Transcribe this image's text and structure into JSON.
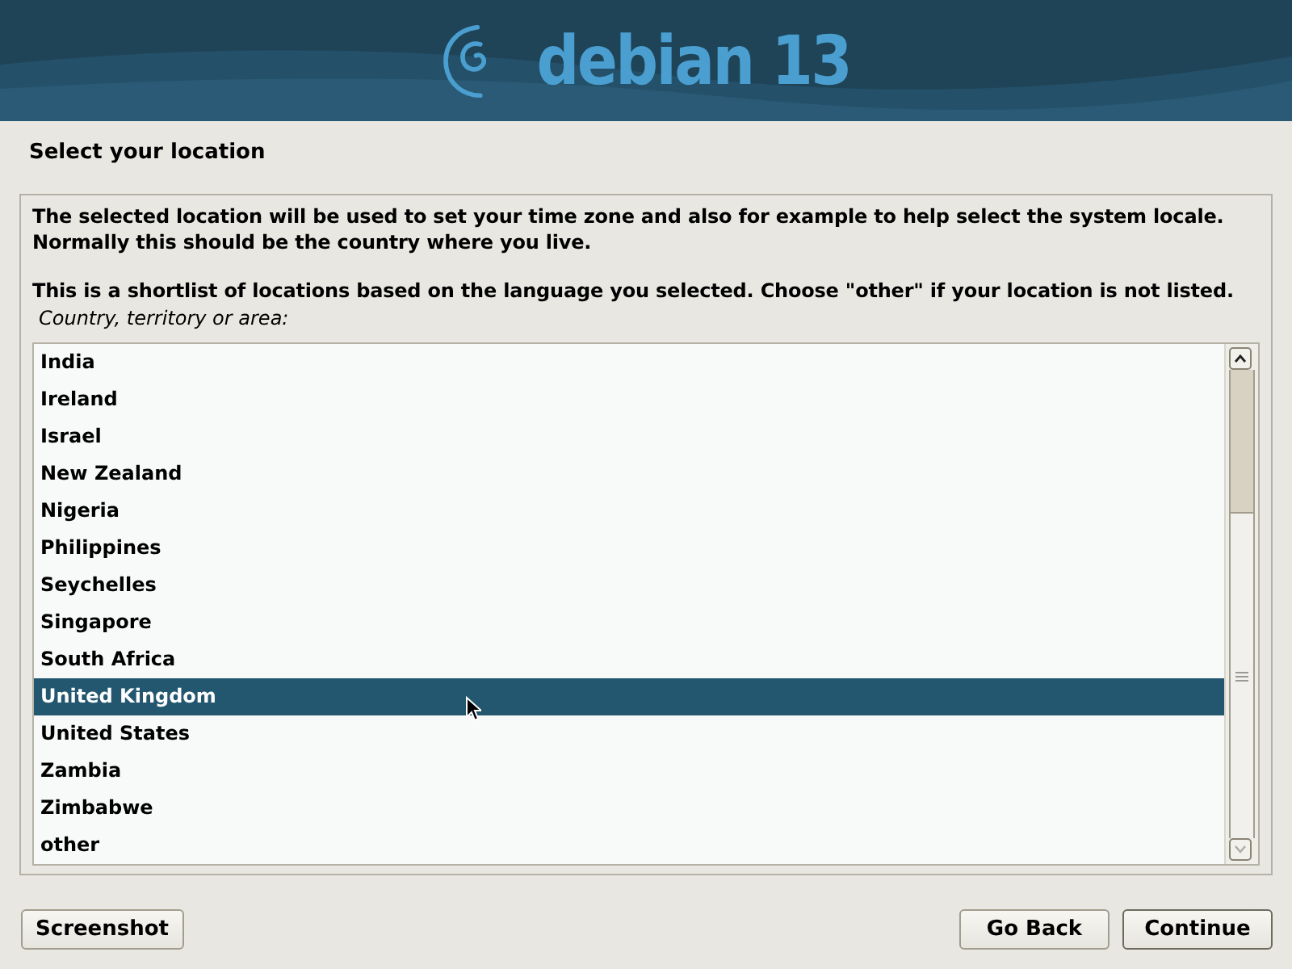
{
  "banner": {
    "logo_text": "debian 13"
  },
  "title": "Select your location",
  "description": [
    "The selected location will be used to set your time zone and also for example to help select the system locale. Normally this should be the country where you live.",
    "This is a shortlist of locations based on the language you selected. Choose \"other\" if your location is not listed."
  ],
  "list": {
    "label": "Country, territory or area:",
    "items": [
      {
        "label": "India",
        "selected": false
      },
      {
        "label": "Ireland",
        "selected": false
      },
      {
        "label": "Israel",
        "selected": false
      },
      {
        "label": "New Zealand",
        "selected": false
      },
      {
        "label": "Nigeria",
        "selected": false
      },
      {
        "label": "Philippines",
        "selected": false
      },
      {
        "label": "Seychelles",
        "selected": false
      },
      {
        "label": "Singapore",
        "selected": false
      },
      {
        "label": "South Africa",
        "selected": false
      },
      {
        "label": "United Kingdom",
        "selected": true
      },
      {
        "label": "United States",
        "selected": false
      },
      {
        "label": "Zambia",
        "selected": false
      },
      {
        "label": "Zimbabwe",
        "selected": false
      },
      {
        "label": "other",
        "selected": false
      }
    ]
  },
  "buttons": {
    "left": [
      "Screenshot"
    ],
    "right": [
      "Go Back",
      "Continue"
    ]
  }
}
